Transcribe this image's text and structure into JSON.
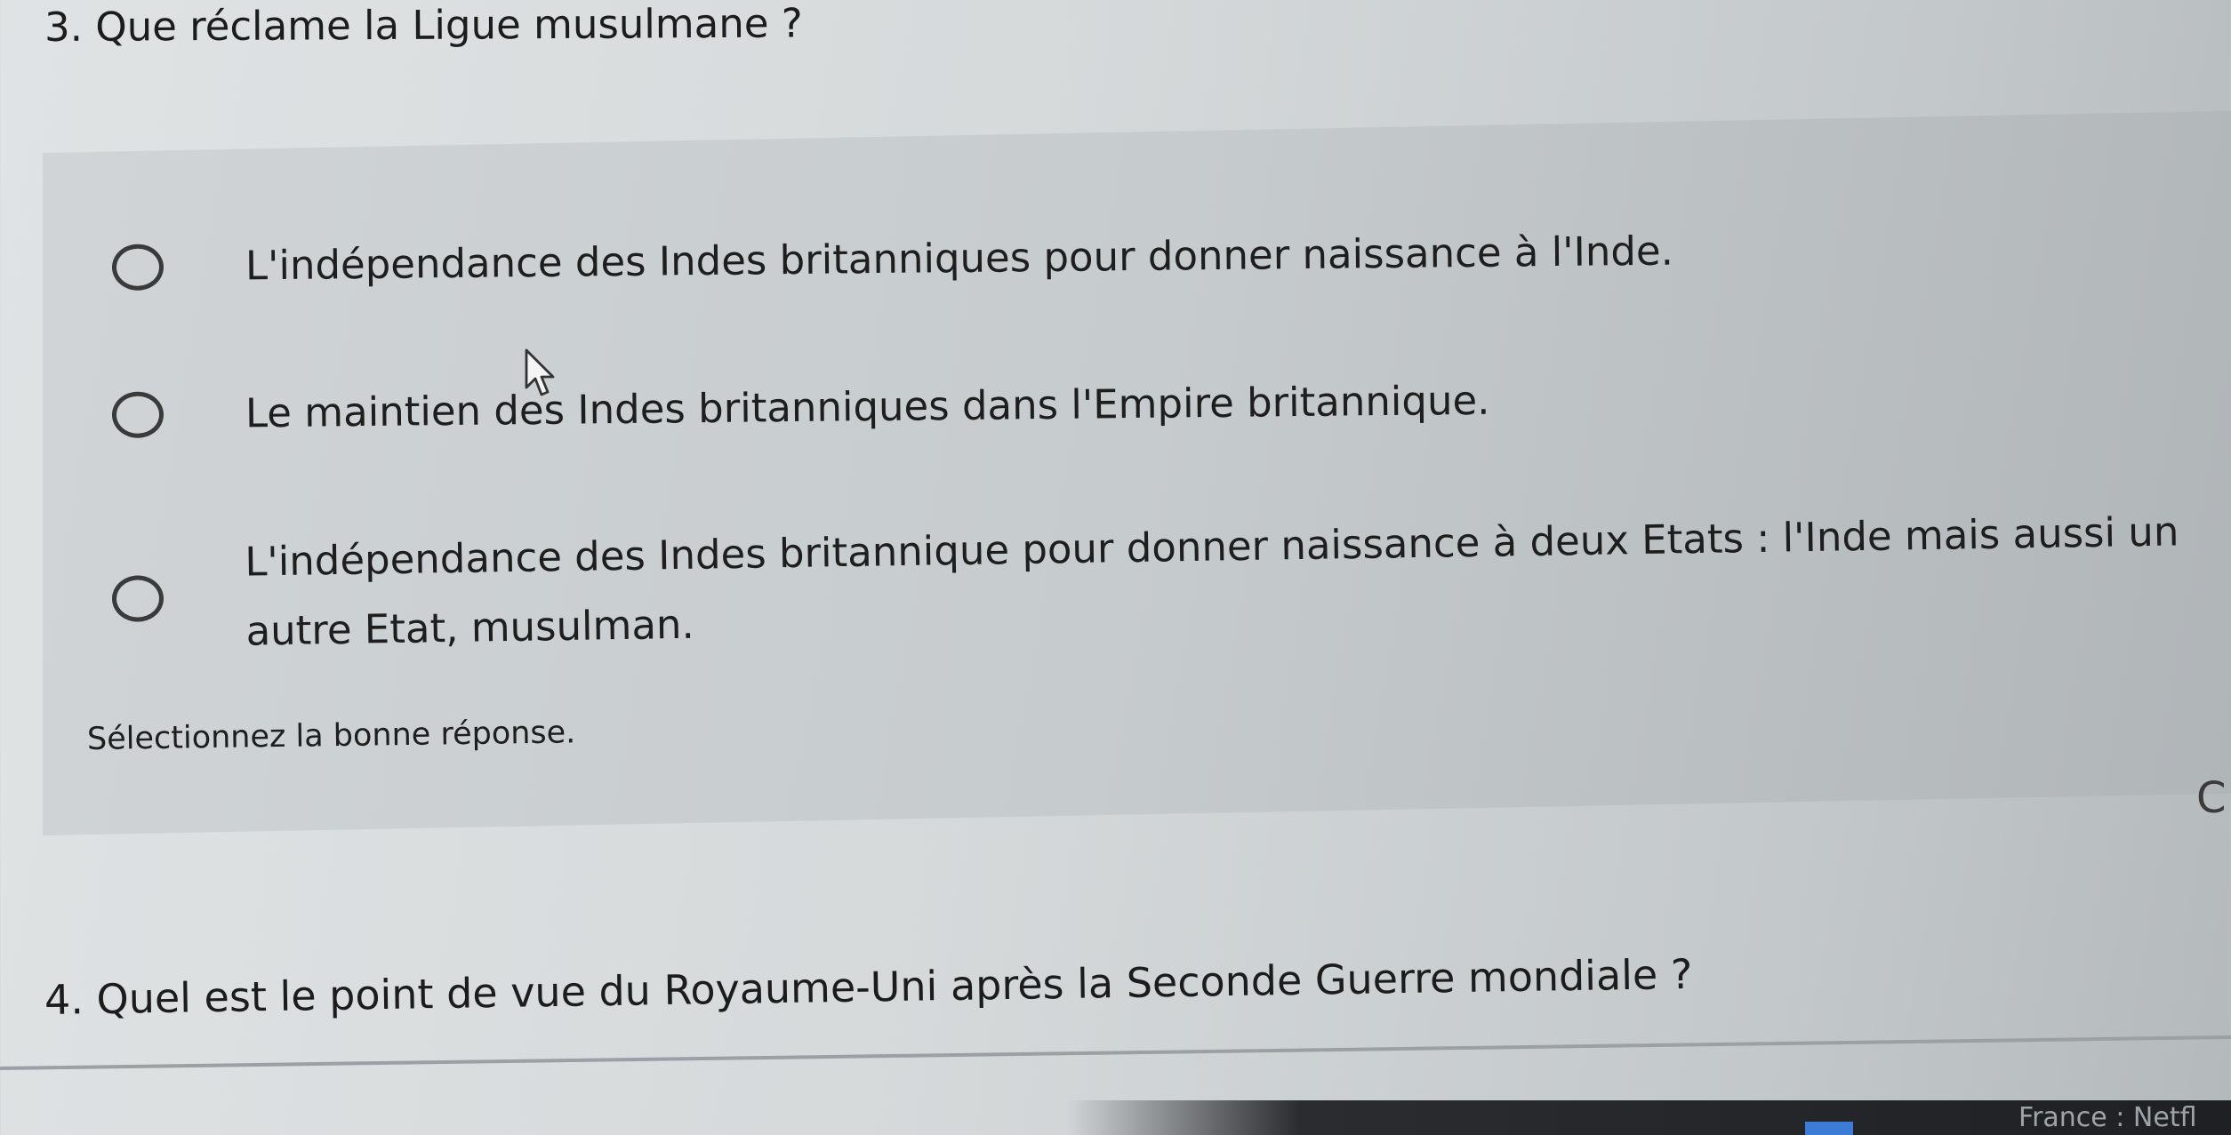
{
  "question3": {
    "title": "3. Que réclame la Ligue musulmane ?",
    "options": [
      {
        "label": "L'indépendance des Indes britanniques pour donner naissance à l'Inde."
      },
      {
        "label": "Le maintien des Indes britanniques dans l'Empire britannique."
      },
      {
        "label": "L'indépendance des Indes britannique pour donner naissance à deux Etats : l'Inde mais aussi un autre Etat, musulman."
      }
    ],
    "hint": "Sélectionnez la bonne réponse."
  },
  "question4": {
    "title": "4. Quel est le point de vue du Royaume-Uni après la Seconde Guerre mondiale ?"
  },
  "edge_text": "C",
  "taskbar": {
    "text": "France : Netfl"
  },
  "colors": {
    "text": "#1e1e1e",
    "card": "#c6cbcd",
    "radio_border": "#3a3a3a",
    "taskbar": "#1e2024",
    "taskbar_icon": "#3c7bd6"
  },
  "icons": [
    "radio-unchecked-icon",
    "mouse-pointer-icon"
  ]
}
